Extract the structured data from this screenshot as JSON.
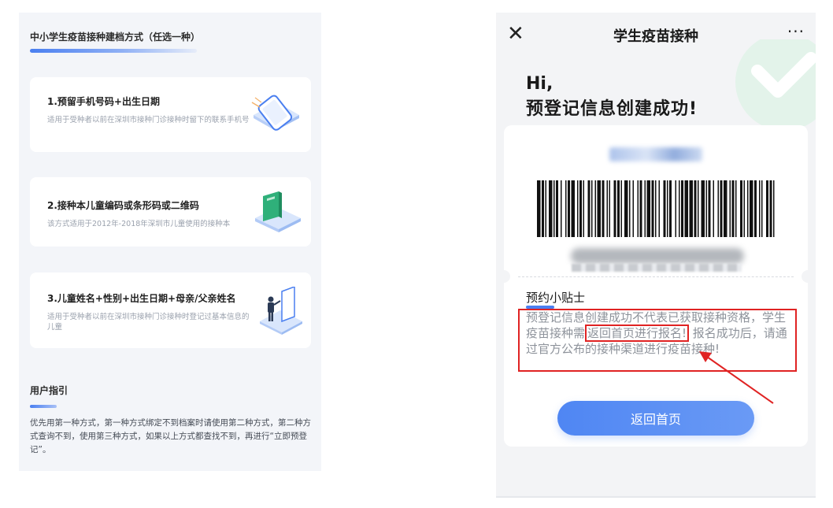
{
  "left": {
    "title": "中小学生疫苗接种建档方式（任选一种）",
    "methods": [
      {
        "title": "1.预留手机号码+出生日期",
        "desc": "适用于受种者以前在深圳市接种门诊接种时留下的联系手机号",
        "icon": "phone-icon"
      },
      {
        "title": "2.接种本儿童编码或条形码或二维码",
        "desc": "该方式适用于2012年-2018年深圳市儿童使用的接种本",
        "icon": "book-icon"
      },
      {
        "title": "3.儿童姓名+性别+出生日期+母亲/父亲姓名",
        "desc": "适用于受种者以前在深圳市接种门诊接种时登记过基本信息的儿童",
        "icon": "person-icon"
      }
    ],
    "guide": {
      "title": "用户指引",
      "text": "优先用第一种方式，第一种方式绑定不到档案时请使用第二种方式，第二种方式查询不到，使用第三种方式，如果以上方式都查找不到，再进行“立即预登记”。"
    }
  },
  "phone": {
    "nav": {
      "close": "✕",
      "title": "学生疫苗接种",
      "more": "···"
    },
    "greeting": "Hi,",
    "success": "预登记信息创建成功!",
    "tips": {
      "title": "预约小贴士",
      "before": "预登记信息创建成功不代表已获取接种资格，学生疫苗接种需",
      "highlight": "返回首页进行报名!",
      "after": " 报名成功后，请通过官方公布的接种渠道进行疫苗接种!"
    },
    "home_button": "返回首页"
  },
  "colors": {
    "accent": "#4a7ff0",
    "annotation_red": "#e02323"
  }
}
